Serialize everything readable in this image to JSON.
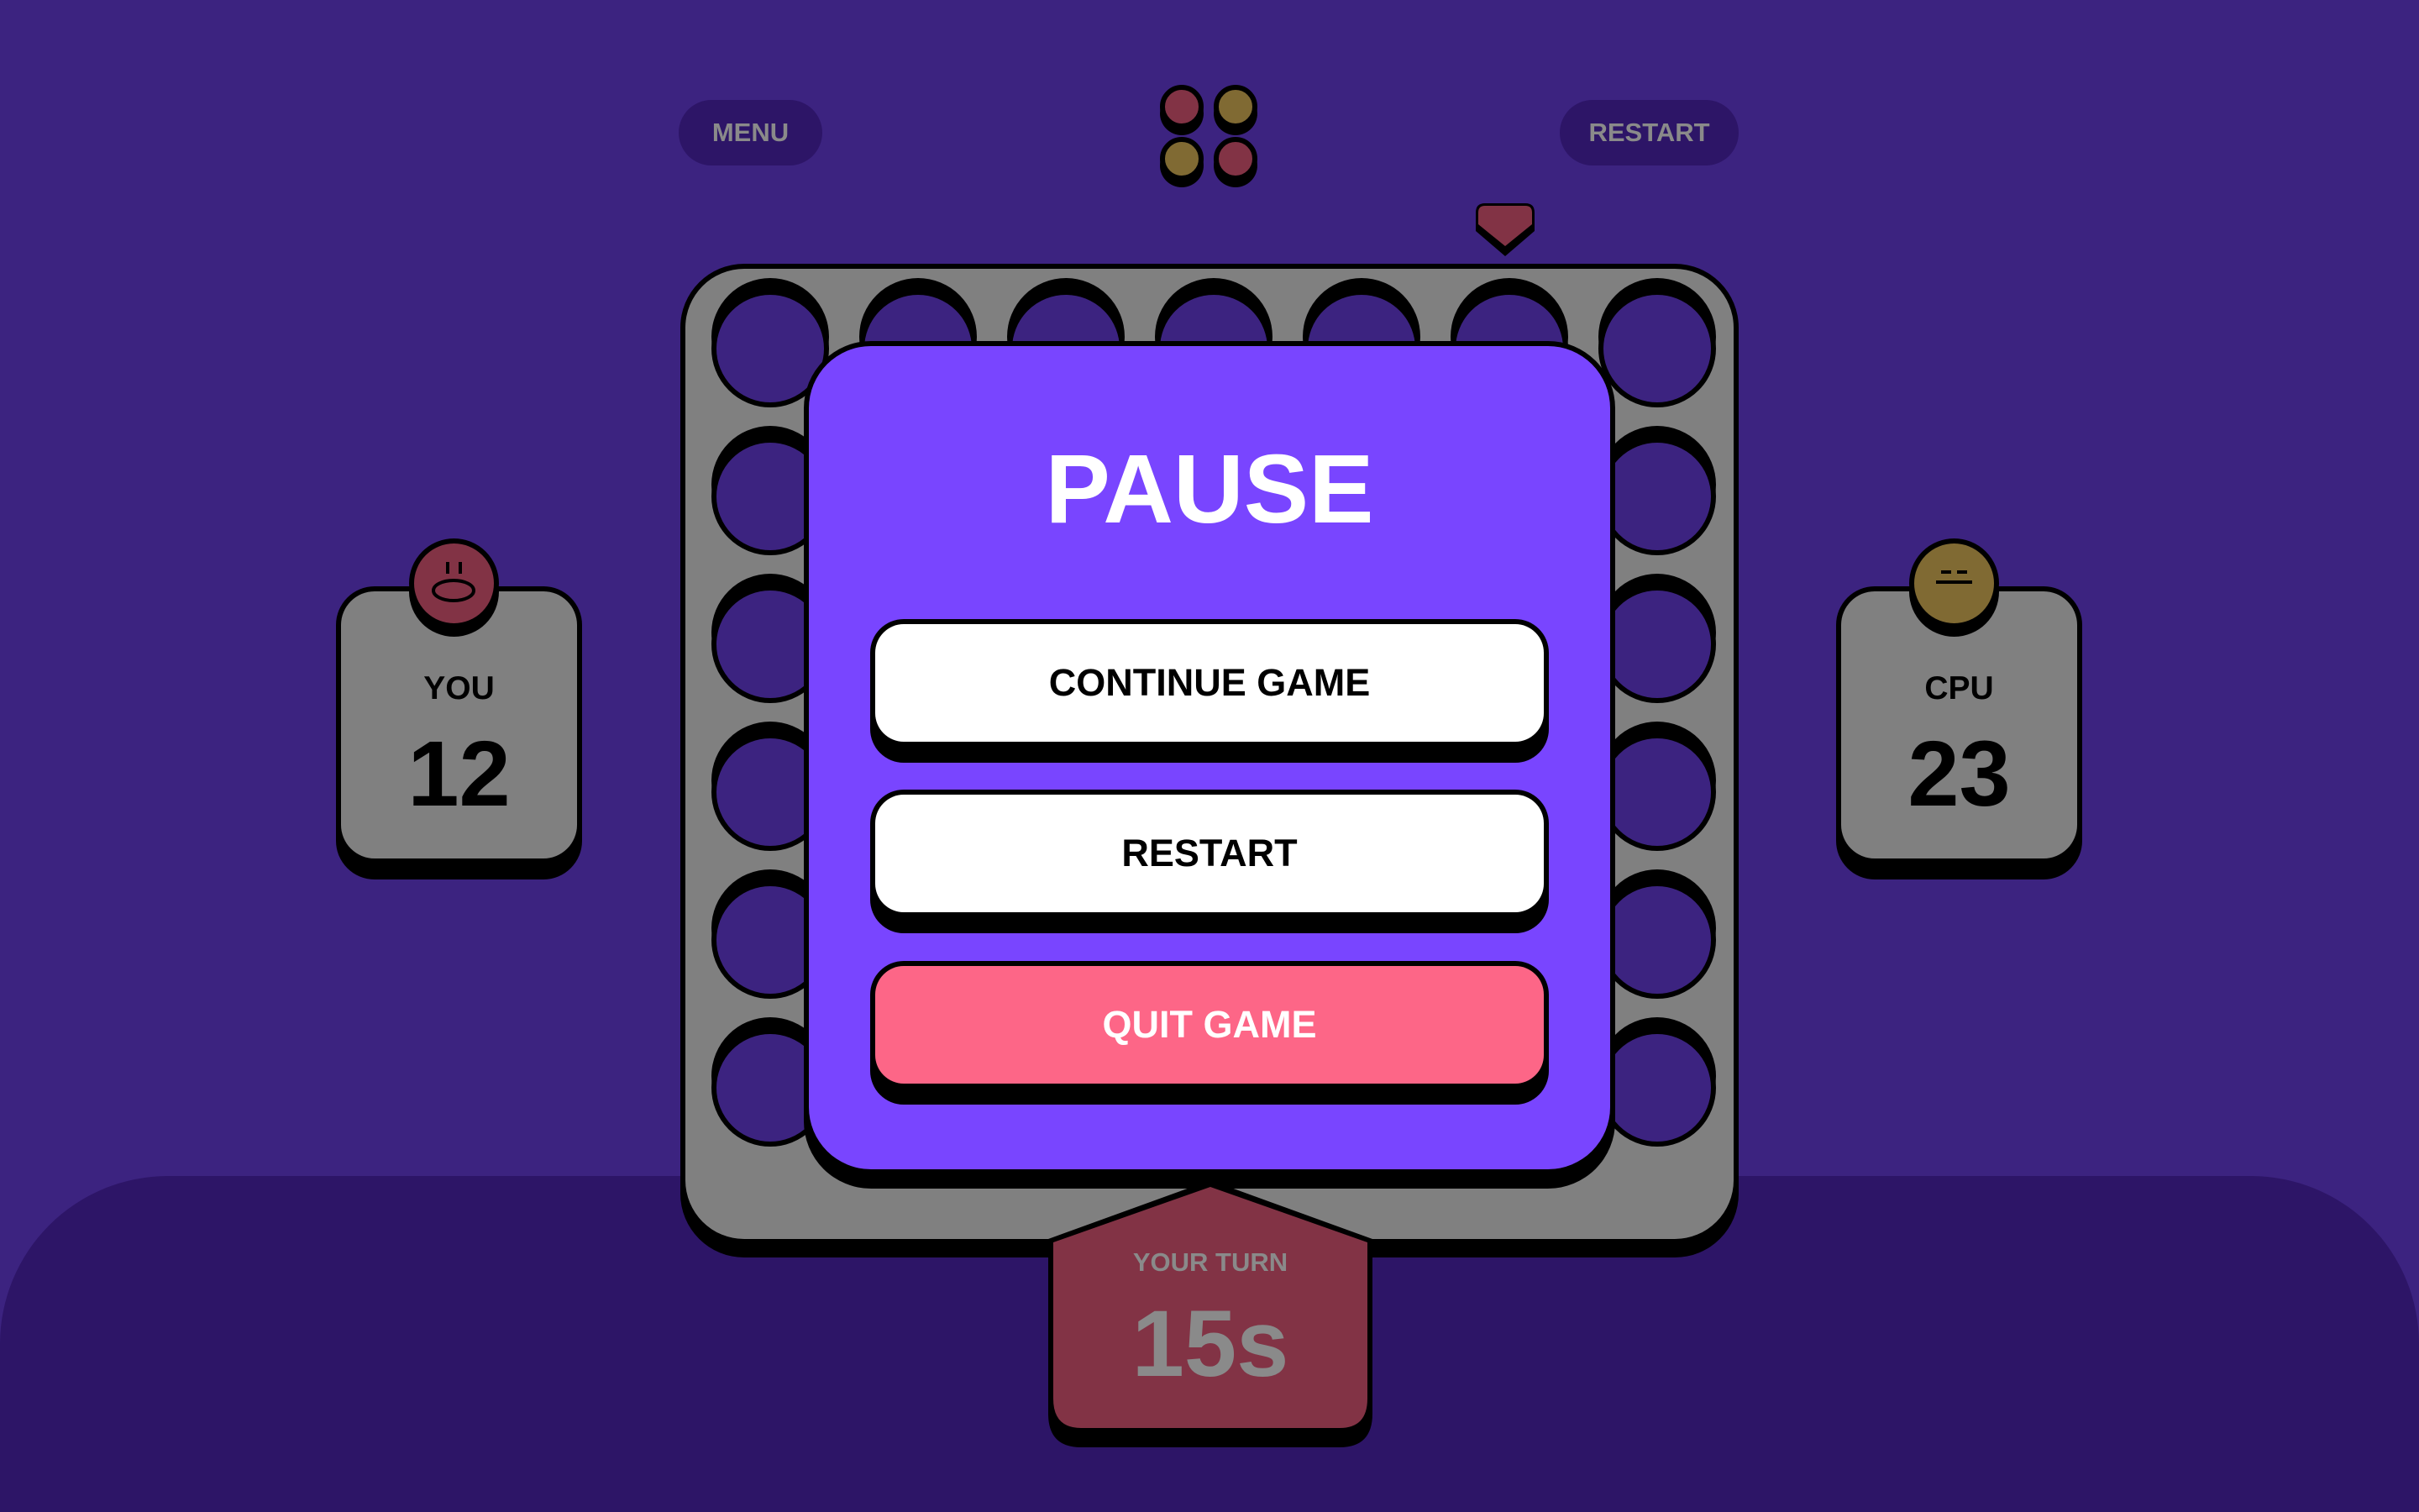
{
  "header": {
    "menu_label": "MENU",
    "restart_label": "RESTART",
    "logo": "connect-four-logo-icon"
  },
  "colors": {
    "background": "#3c2380",
    "bottom": "#2d1567",
    "player1": "#823345",
    "player2": "#806a33",
    "board": "#808080",
    "modal": "#7945ff",
    "quit": "#fd6687"
  },
  "board": {
    "columns": 7,
    "rows": 6,
    "active_column": 6
  },
  "pause": {
    "title": "PAUSE",
    "continue_label": "CONTINUE GAME",
    "restart_label": "RESTART",
    "quit_label": "QUIT GAME"
  },
  "players": [
    {
      "name": "YOU",
      "score": "12"
    },
    {
      "name": "CPU",
      "score": "23"
    }
  ],
  "turn": {
    "label": "YOUR TURN",
    "timer": "15s"
  }
}
